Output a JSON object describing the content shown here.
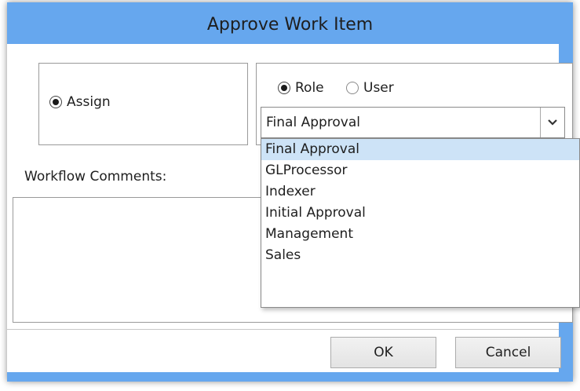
{
  "dialog": {
    "title": "Approve Work Item"
  },
  "assign_panel": {
    "assign_label": "Assign",
    "assign_checked": true
  },
  "target_panel": {
    "role_label": "Role",
    "role_checked": true,
    "user_label": "User",
    "user_checked": false
  },
  "role_select": {
    "value": "Final Approval",
    "options": [
      "Final Approval",
      "GLProcessor",
      "Indexer",
      "Initial Approval",
      "Management",
      "Sales"
    ],
    "highlighted_index": 0
  },
  "comments": {
    "label": "Workflow Comments:",
    "value": ""
  },
  "buttons": {
    "ok_label": "OK",
    "cancel_label": "Cancel"
  },
  "colors": {
    "title_bar": "#66a7ee",
    "selection": "#cde3f7"
  },
  "icons": {
    "dropdown": "chevron-down-icon"
  }
}
